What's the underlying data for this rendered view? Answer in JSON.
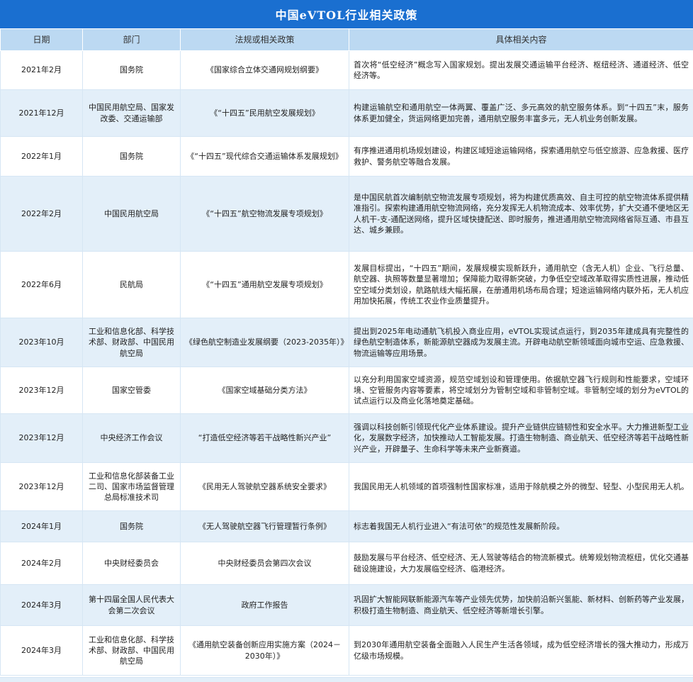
{
  "title": "中国eVTOL行业相关政策",
  "headers": [
    "日期",
    "部门",
    "法规或相关政策",
    "具体相关内容"
  ],
  "rows": [
    {
      "date": "2021年2月",
      "dept": "国务院",
      "policy": "《国家综合立体交通网规划纲要》",
      "content": "首次将“低空经济”概念写入国家规划。提出发展交通运输平台经济、枢纽经济、通道经济、低空经济等。"
    },
    {
      "date": "2021年12月",
      "dept": "中国民用航空局、国家发改委、交通运输部",
      "policy": "《“十四五”民用航空发展规划》",
      "content": "构建运输航空和通用航空一体两翼、覆盖广泛、多元高效的航空服务体系。到“十四五”末，服务体系更加健全，货运网络更加完善，通用航空服务丰富多元，无人机业务创新发展。"
    },
    {
      "date": "2022年1月",
      "dept": "国务院",
      "policy": "《“十四五”现代综合交通运输体系发展规划》",
      "content": "有序推进通用机场规划建设，构建区域短途运输网络，探索通用航空与低空旅游、应急救援、医疗救护、警务航空等融合发展。"
    },
    {
      "date": "2022年2月",
      "dept": "中国民用航空局",
      "policy": "《“十四五”航空物流发展专项规划》",
      "content": "是中国民航首次编制航空物流发展专项规划，将为构建优质高效、自主可控的航空物流体系提供精准指引。探索构建通用航空物流网络，充分发挥无人机物流成本、效率优势，扩大交通不便地区无人机干-支-通配送网络，提升区域快捷配送、即时服务，推进通用航空物流网络省际互通、市县互达、城乡兼顾。"
    },
    {
      "date": "2022年6月",
      "dept": "民航局",
      "policy": "《“十四五”通用航空发展专项规划》",
      "content": "发展目标提出，“十四五”期间，发展规模实现新跃升，通用航空（含无人机）企业、飞行总量、航空器、执照等数量显著增加；保障能力取得新突破，力争低空空域改革取得实质性进展，推动低空空域分类划设，航路航线大幅拓展，在册通用机场布局合理；短途运输网络内联外拓，无人机应用加快拓展，传统工农业作业质量提升。"
    },
    {
      "date": "2023年10月",
      "dept": "工业和信息化部、科学技术部、财政部、中国民用航空局",
      "policy": "《绿色航空制造业发展纲要（2023-2035年）》",
      "content": "提出到2025年电动通航飞机投入商业应用，eVTOL实现试点运行，到2035年建成具有完整性的绿色航空制造体系，新能源航空器成为发展主流。开辟电动航空新领域面向城市空运、应急救援、物流运输等应用场景。"
    },
    {
      "date": "2023年12月",
      "dept": "国家空管委",
      "policy": "《国家空域基础分类方法》",
      "content": "以充分利用国家空域资源，规范空域划设和管理使用。依据航空器飞行规则和性能要求，空域环境、空管服务内容等要素，将空域划分为管制空域和非管制空域。非管制空域的划分为eVTOL的试点运行以及商业化落地奠定基础。"
    },
    {
      "date": "2023年12月",
      "dept": "中央经济工作会议",
      "policy": "“打造低空经济等若干战略性新兴产业”",
      "content": "强调以科技创新引领现代化产业体系建设。提升产业链供应链韧性和安全水平。大力推进新型工业化，发展数字经济，加快推动人工智能发展。打造生物制造、商业航天、低空经济等若干战略性新兴产业，开辟量子、生命科学等未来产业新赛道。"
    },
    {
      "date": "2023年12月",
      "dept": "工业和信息化部装备工业二司、国家市场监督管理总局标准技术司",
      "policy": "《民用无人驾驶航空器系统安全要求》",
      "content": "我国民用无人机领域的首项强制性国家标准，适用于除航模之外的微型、轻型、小型民用无人机。"
    },
    {
      "date": "2024年1月",
      "dept": "国务院",
      "policy": "《无人驾驶航空器飞行管理暂行条例》",
      "content": "标志着我国无人机行业进入“有法可依”的规范性发展新阶段。"
    },
    {
      "date": "2024年2月",
      "dept": "中央财经委员会",
      "policy": "中央财经委员会第四次会议",
      "content": "鼓励发展与平台经济、低空经济、无人驾驶等结合的物流新模式。统筹规划物流枢纽，优化交通基础设施建设，大力发展临空经济、临港经济。"
    },
    {
      "date": "2024年3月",
      "dept": "第十四届全国人民代表大会第二次会议",
      "policy": "政府工作报告",
      "content": "巩固扩大智能网联新能源汽车等产业领先优势，加快前沿新兴氢能、新材料、创新药等产业发展，积极打造生物制造、商业航天、低空经济等新增长引擎。"
    },
    {
      "date": "2024年3月",
      "dept": "工业和信息化部、科学技术部、财政部、中国民用航空局",
      "policy": "《通用航空装备创新应用实施方案（2024－2030年）》",
      "content": "到2030年通用航空装备全面融入人民生产生活各领域，成为低空经济增长的强大推动力，形成万亿级市场规模。"
    }
  ]
}
